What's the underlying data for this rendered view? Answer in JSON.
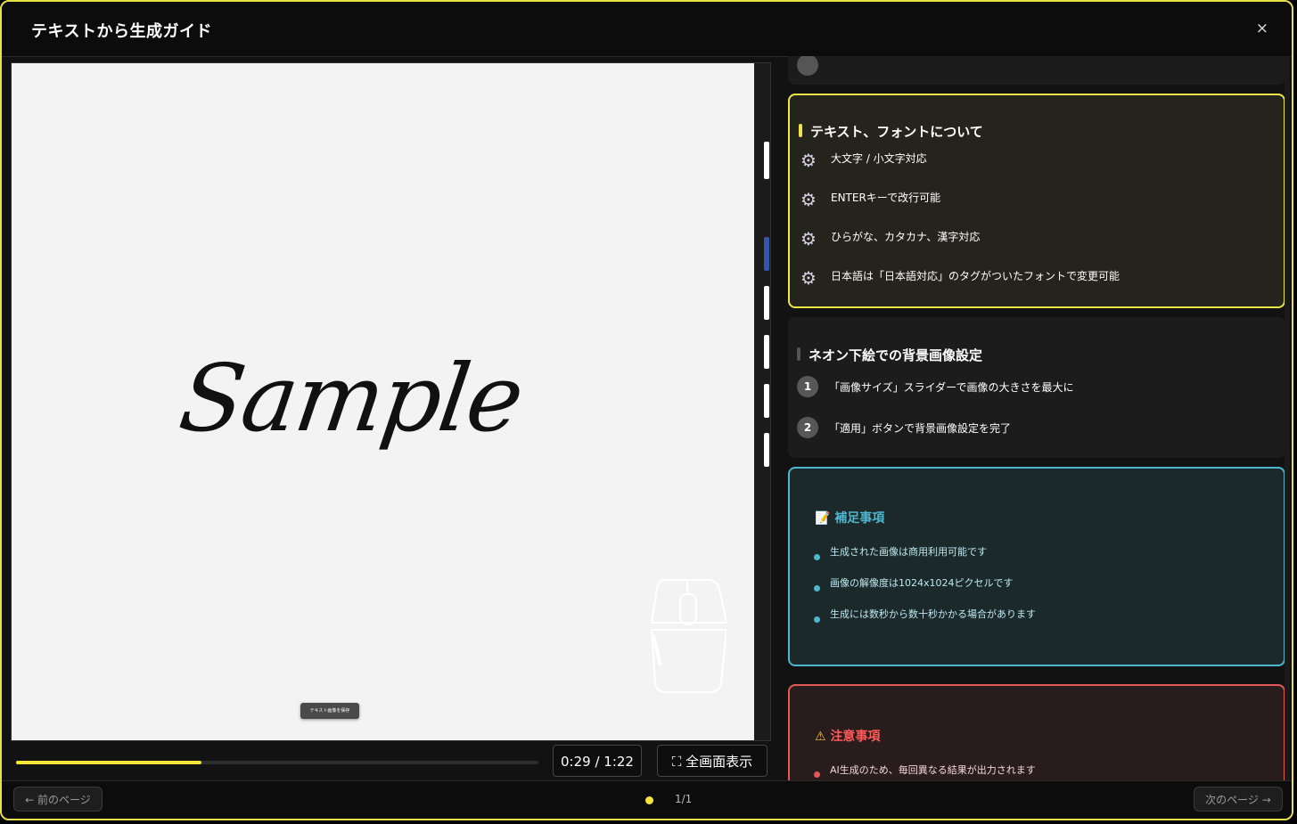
{
  "header": {
    "title": "テキストから生成ガイド",
    "close_label": "×"
  },
  "video": {
    "sample_text": "Sample",
    "save_button_label": "テキスト画像を保存",
    "progress": 0.355,
    "time_display": "0:29 / 1:22",
    "fullscreen_label": "⛶ 全画面表示"
  },
  "font_section": {
    "title": "テキスト、フォントについて",
    "accent_color": "#ece54a",
    "items": [
      "大文字 / 小文字対応",
      "ENTERキーで改行可能",
      "ひらがな、カタカナ、漢字対応",
      "日本語は「日本語対応」のタグがついたフォントで変更可能"
    ]
  },
  "neon_section": {
    "title": "ネオン下絵での背景画像設定",
    "steps": [
      {
        "num": "1",
        "text": "「画像サイズ」スライダーで画像の大きさを最大に"
      },
      {
        "num": "2",
        "text": "「適用」ボタンで背景画像設定を完了"
      }
    ]
  },
  "info_section": {
    "title": "補足事項",
    "icon": "memo-icon",
    "accent_color": "#4fb6cf",
    "items": [
      "生成された画像は商用利用可能です",
      "画像の解像度は1024x1024ピクセルです",
      "生成には数秒から数十秒かかる場合があります"
    ]
  },
  "warn_section": {
    "title": "注意事項",
    "icon": "warning-icon",
    "accent_color": "#e25858",
    "items": [
      "AI生成のため、毎回異なる結果が出力されます"
    ]
  },
  "footer": {
    "prev_label": "← 前のページ",
    "next_label": "次のページ →",
    "page_indicator": "1/1"
  }
}
